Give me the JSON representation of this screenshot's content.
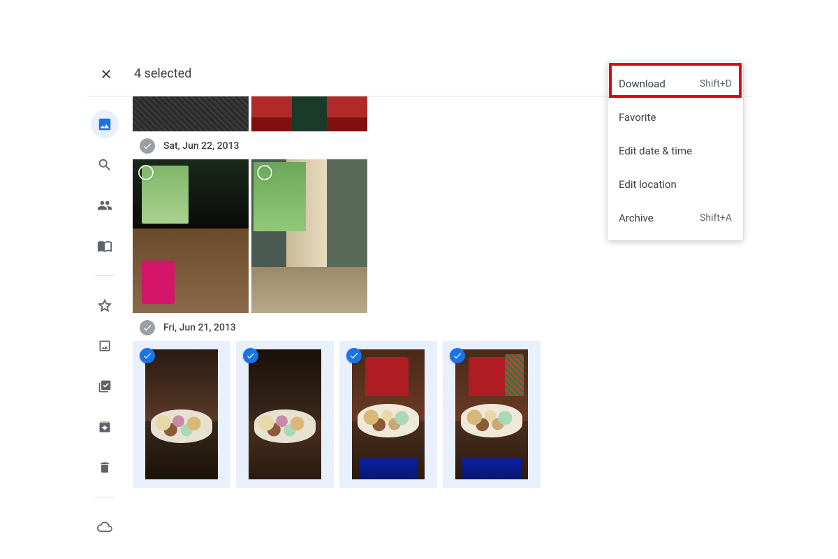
{
  "topbar": {
    "selection_text": "4 selected"
  },
  "menu": {
    "items": [
      {
        "label": "Download",
        "shortcut": "Shift+D"
      },
      {
        "label": "Favorite",
        "shortcut": ""
      },
      {
        "label": "Edit date & time",
        "shortcut": ""
      },
      {
        "label": "Edit location",
        "shortcut": ""
      },
      {
        "label": "Archive",
        "shortcut": "Shift+A"
      }
    ],
    "highlighted_index": 0
  },
  "groups": [
    {
      "date_label": "Sat, Jun 22, 2013",
      "photo_count": 2,
      "all_selected": false
    },
    {
      "date_label": "Fri, Jun 21, 2013",
      "photo_count": 4,
      "all_selected": true
    }
  ]
}
